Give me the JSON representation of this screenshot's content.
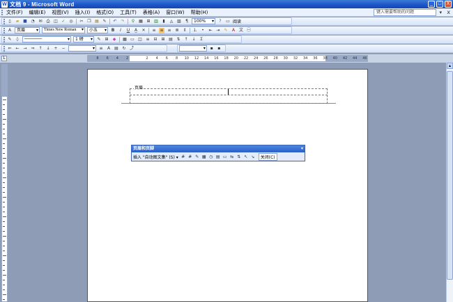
{
  "window": {
    "title": "文档 9 - Microsoft Word",
    "app_icon": "W",
    "minimize": "_",
    "maximize": "□",
    "close": "X"
  },
  "menu": {
    "items": [
      "文件(F)",
      "编辑(E)",
      "视图(V)",
      "插入(I)",
      "格式(O)",
      "工具(T)",
      "表格(A)",
      "窗口(W)",
      "帮助(H)"
    ],
    "help_placeholder": "键入需要帮助的问题",
    "doc_close": "x"
  },
  "standard_toolbar": {
    "zoom": "100%",
    "read_label": "阅读"
  },
  "formatting_toolbar": {
    "style": "页眉",
    "font": "Times New Roman",
    "size": "小五",
    "bold": "B",
    "italic": "I",
    "underline": "U"
  },
  "drawing_toolbar": {
    "percent": "%",
    "mid_label": "1 磅"
  },
  "ruler": {
    "h_labels": [
      "8",
      "6",
      "4",
      "2",
      "",
      "2",
      "4",
      "6",
      "8",
      "10",
      "12",
      "14",
      "16",
      "18",
      "20",
      "22",
      "24",
      "26",
      "28",
      "30",
      "32",
      "34",
      "36",
      "38",
      "40",
      "42",
      "44",
      "46"
    ],
    "corner": "L"
  },
  "document": {
    "header_label": "页眉"
  },
  "header_footer_toolbar": {
    "title": "页眉和页脚",
    "insert_autotext": "插入 \"自动图文集\" (S) ▾",
    "close": "关闭(C)"
  }
}
